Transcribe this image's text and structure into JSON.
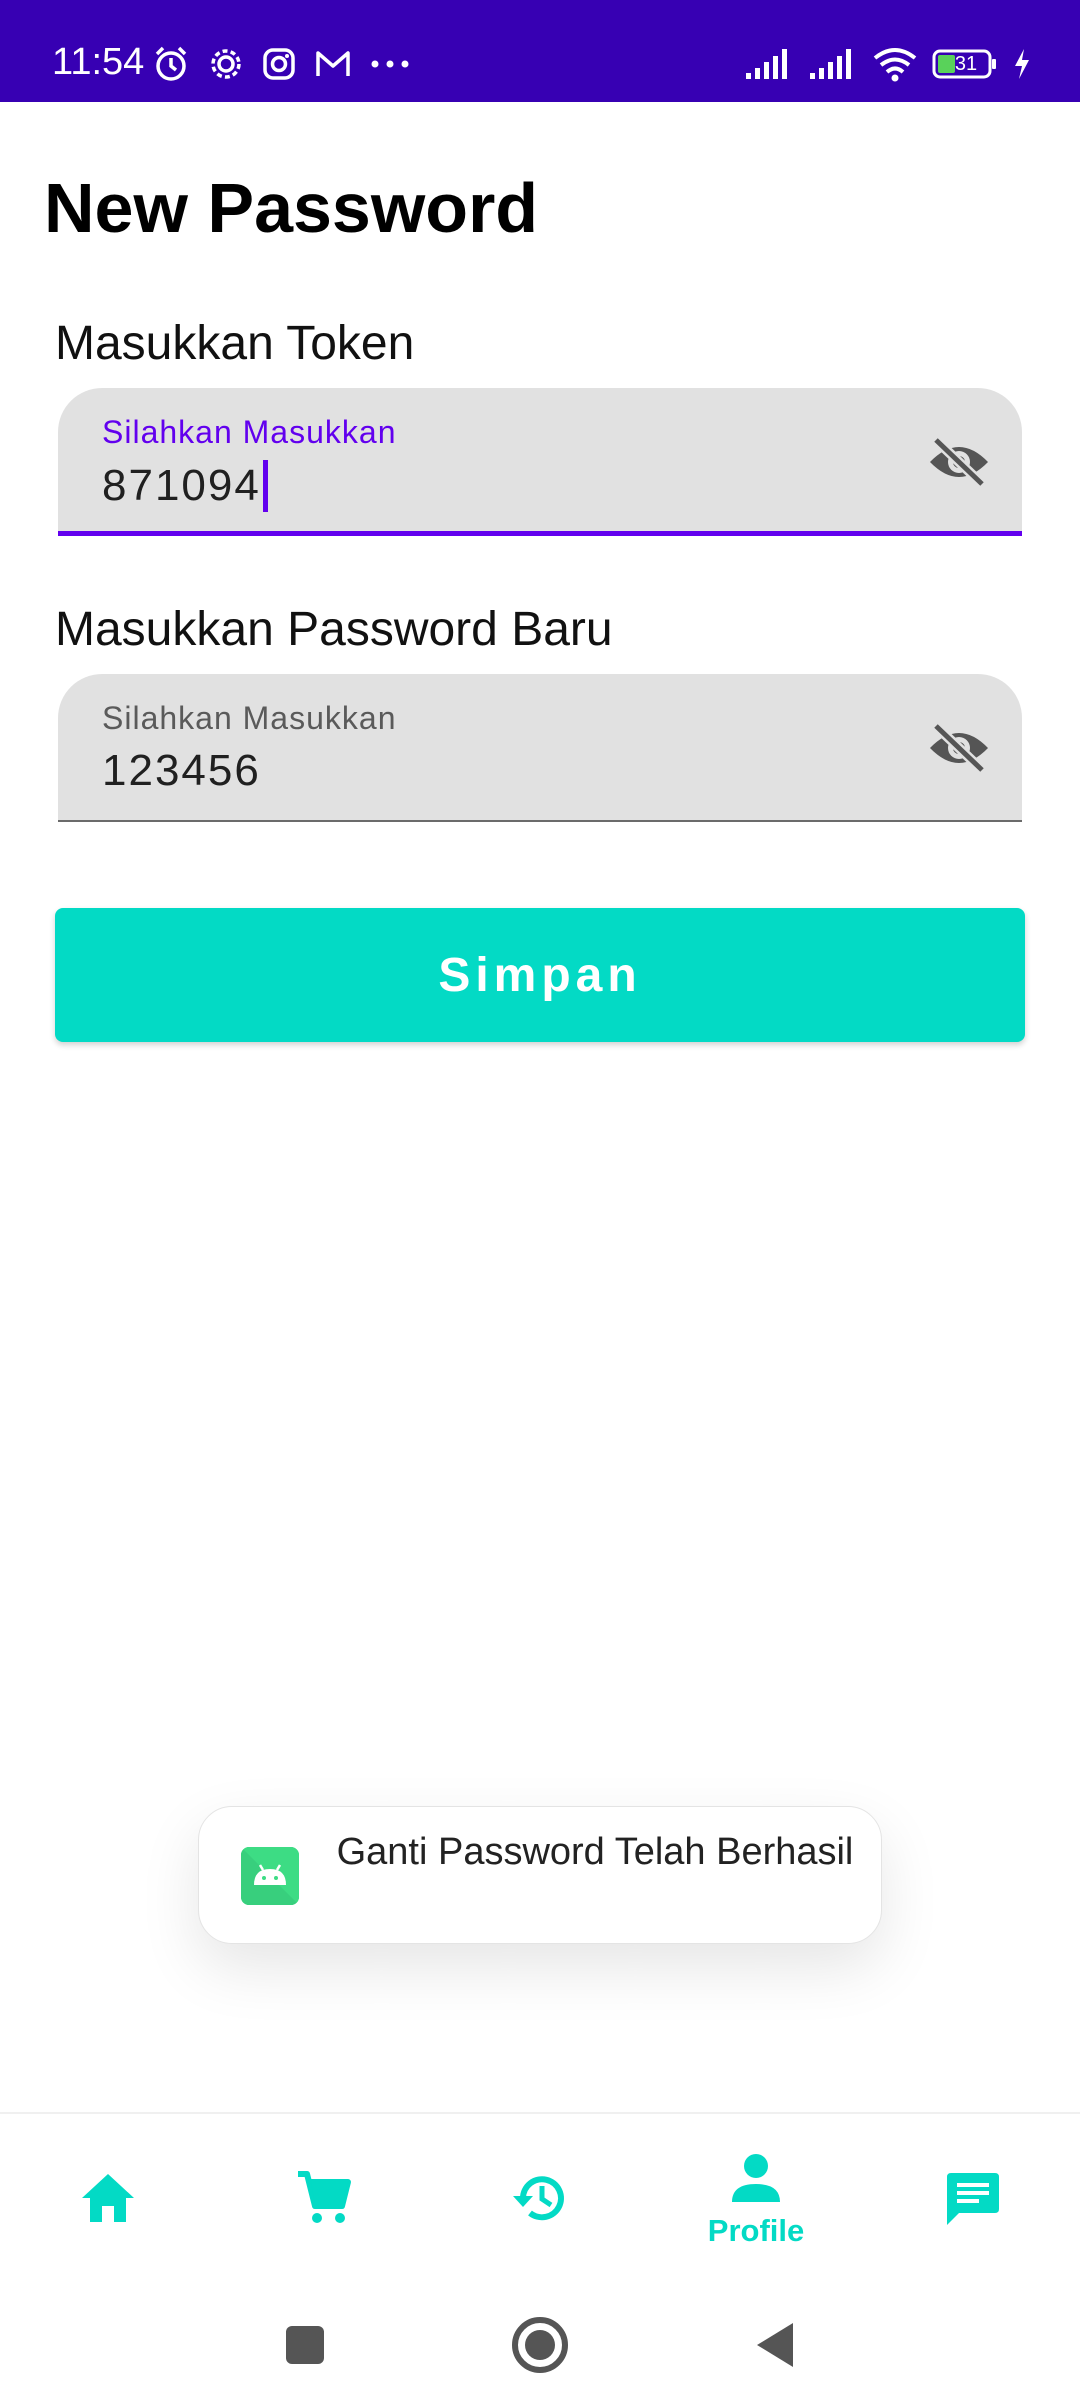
{
  "status_bar": {
    "time": "11:54",
    "battery_level": "31",
    "background": "#3700B3",
    "left_icons": [
      "alarm-icon",
      "settings-icon",
      "instagram-icon",
      "gmail-icon",
      "more-icon"
    ],
    "right_icons": [
      "signal-icon",
      "signal-icon",
      "wifi-icon",
      "battery-icon",
      "charging-icon"
    ]
  },
  "page": {
    "title": "New Password"
  },
  "token_field": {
    "label": "Masukkan Token",
    "floating_label": "Silahkan Masukkan",
    "value": "871094",
    "focused": true,
    "toggle_icon": "visibility-off-icon"
  },
  "password_field": {
    "label": "Masukkan Password Baru",
    "floating_label": "Silahkan Masukkan",
    "value": "123456",
    "focused": false,
    "toggle_icon": "visibility-off-icon"
  },
  "save_button": {
    "label": "Simpan",
    "color": "#03DAC5"
  },
  "toast": {
    "message": "Ganti Password Telah Berhasil",
    "icon": "android-app-icon"
  },
  "bottom_nav": {
    "accent": "#03DAC5",
    "items": [
      {
        "icon": "home-icon",
        "label": ""
      },
      {
        "icon": "cart-icon",
        "label": ""
      },
      {
        "icon": "history-icon",
        "label": ""
      },
      {
        "icon": "profile-icon",
        "label": "Profile",
        "selected": true
      },
      {
        "icon": "chat-icon",
        "label": ""
      }
    ]
  },
  "system_nav": {
    "buttons": [
      "recents-button",
      "home-button",
      "back-button"
    ]
  }
}
